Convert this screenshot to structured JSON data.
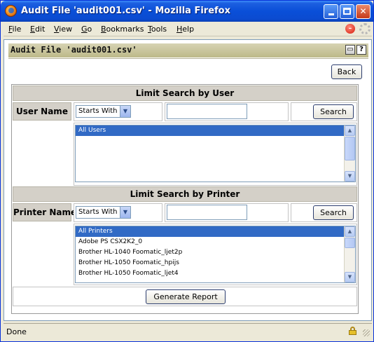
{
  "window": {
    "title": "Audit File 'audit001.csv' - Mozilla Firefox"
  },
  "menu": {
    "items": [
      {
        "key": "F",
        "rest": "ile"
      },
      {
        "key": "E",
        "rest": "dit"
      },
      {
        "key": "V",
        "rest": "iew"
      },
      {
        "key": "G",
        "rest": "o"
      },
      {
        "key": "B",
        "rest": "ookmarks"
      },
      {
        "key": "T",
        "rest": "ools"
      },
      {
        "key": "H",
        "rest": "elp"
      }
    ]
  },
  "page": {
    "header_title": "Audit File 'audit001.csv'",
    "back_label": "Back"
  },
  "user_section": {
    "title": "Limit Search by User",
    "label": "User Name",
    "filter_selected": "Starts With",
    "search_value": "",
    "search_label": "Search",
    "list": [
      "All Users"
    ],
    "selected_index": 0
  },
  "printer_section": {
    "title": "Limit Search by Printer",
    "label": "Printer Name",
    "filter_selected": "Starts With",
    "search_value": "",
    "search_label": "Search",
    "list": [
      "All Printers",
      "Adobe PS CSX2K2_0",
      "Brother HL-1040 Foomatic_ljet2p",
      "Brother HL-1050 Foomatic_hpijs",
      "Brother HL-1050 Foomatic_ljet4"
    ],
    "selected_index": 0
  },
  "generate_label": "Generate Report",
  "status": {
    "text": "Done"
  },
  "colors": {
    "titlebar": "#0a4fd8",
    "selection": "#316ac5",
    "header_band": "#bdb989",
    "section_bg": "#d4d0c8"
  }
}
